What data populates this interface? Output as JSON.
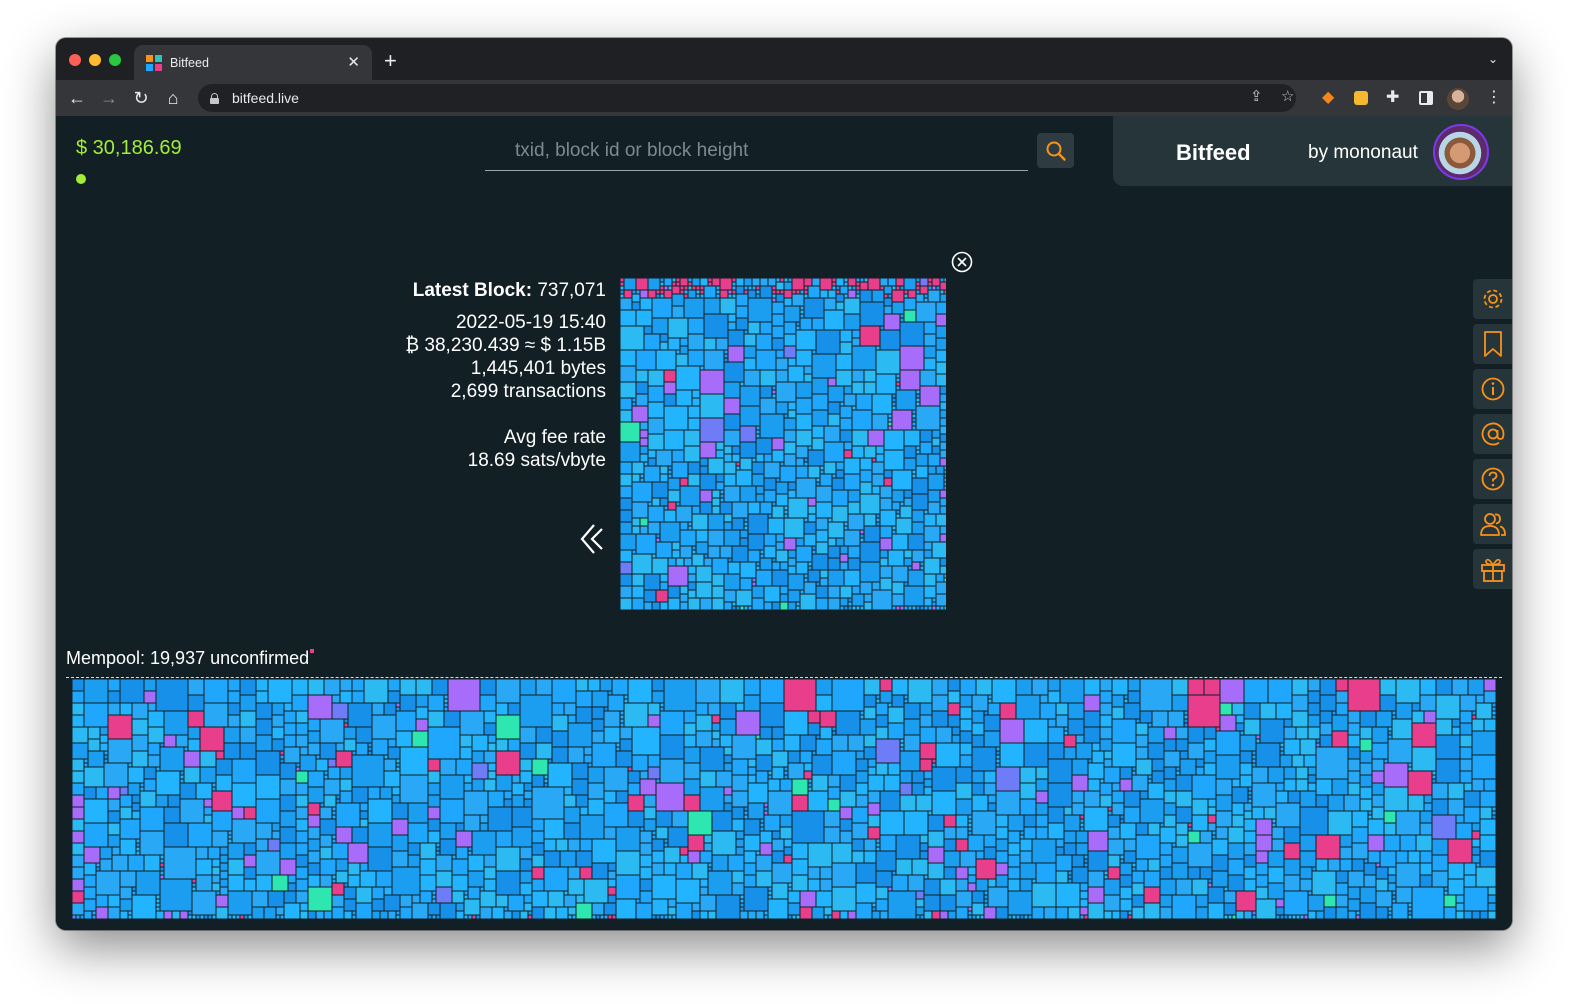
{
  "browser": {
    "tab_title": "Bitfeed",
    "url": "bitfeed.live"
  },
  "header": {
    "price": "$ 30,186.69",
    "search_placeholder": "txid, block id or block height",
    "brand": "Bitfeed",
    "by": "by mononaut"
  },
  "block": {
    "title_label": "Latest Block:",
    "height": "737,071",
    "time": "2022-05-19 15:40",
    "value": "₿ 38,230.439 ≈ $ 1.15B",
    "bytes": "1,445,401 bytes",
    "transactions": "2,699 transactions",
    "fee_label": "Avg fee rate",
    "fee_value": "18.69 sats/vbyte"
  },
  "mempool": {
    "label": "Mempool: 19,937 unconfirmed"
  },
  "side_menu": [
    "settings-icon",
    "bookmark-icon",
    "info-icon",
    "at-icon",
    "help-icon",
    "people-icon",
    "gift-icon"
  ],
  "colors": {
    "background": "#121f24",
    "price": "#a3ec3a",
    "accent": "#f7931a",
    "tx_blue": "#1ea7fd",
    "tx_pink": "#e83e8c",
    "tx_purple": "#a76dfa",
    "tx_teal": "#2ee6b0"
  }
}
